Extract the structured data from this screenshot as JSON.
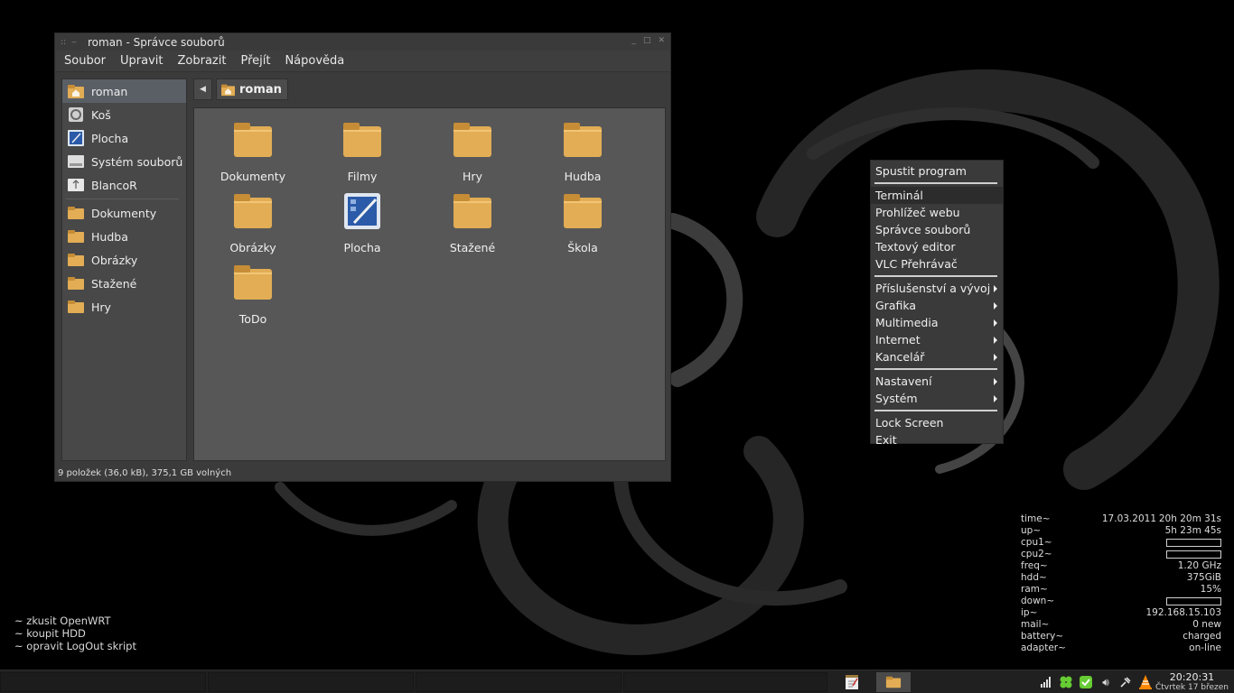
{
  "window": {
    "title": "roman - Správce souborů",
    "menu": [
      "Soubor",
      "Upravit",
      "Zobrazit",
      "Přejít",
      "Nápověda"
    ],
    "sidebar": [
      {
        "label": "roman",
        "icon": "home-icon"
      },
      {
        "label": "Koš",
        "icon": "trash-icon"
      },
      {
        "label": "Plocha",
        "icon": "desktop-icon"
      },
      {
        "label": "Systém souborů",
        "icon": "drive-icon"
      },
      {
        "label": "BlancoR",
        "icon": "usb-drive-icon"
      }
    ],
    "bookmarks": [
      "Dokumenty",
      "Hudba",
      "Obrázky",
      "Stažené",
      "Hry"
    ],
    "path": "roman",
    "files": [
      {
        "name": "Dokumenty",
        "type": "folder"
      },
      {
        "name": "Filmy",
        "type": "folder"
      },
      {
        "name": "Hry",
        "type": "folder"
      },
      {
        "name": "Hudba",
        "type": "folder"
      },
      {
        "name": "Obrázky",
        "type": "folder"
      },
      {
        "name": "Plocha",
        "type": "desktop"
      },
      {
        "name": "Stažené",
        "type": "folder"
      },
      {
        "name": "Škola",
        "type": "folder"
      },
      {
        "name": "ToDo",
        "type": "folder"
      }
    ],
    "status": "9 položek (36,0 kB), 375,1 GB volných"
  },
  "menu": {
    "run": "Spustit program",
    "apps": [
      "Terminál",
      "Prohlížeč webu",
      "Správce souborů",
      "Textový editor",
      "VLC Přehrávač"
    ],
    "highlighted": "Terminál",
    "categories": [
      "Příslušenství a vývoj",
      "Grafika",
      "Multimedia",
      "Internet",
      "Kancelář"
    ],
    "settings": [
      "Nastavení",
      "Systém"
    ],
    "session": [
      "Lock Screen",
      "Exit"
    ]
  },
  "conky": {
    "time_label": "time~",
    "date": "17.03.2011",
    "time": "20h 20m 31s",
    "up_label": "up~",
    "up": "5h 23m 45s",
    "cpu1_label": "cpu1~",
    "cpu2_label": "cpu2~",
    "freq_label": "freq~",
    "freq": "1.20 GHz",
    "hdd_label": "hdd~",
    "hdd": "375GiB",
    "ram_label": "ram~",
    "ram": "15%",
    "down_label": "down~",
    "ip_label": "ip~",
    "ip": "192.168.15.103",
    "mail_label": "mail~",
    "mail": "0 new",
    "battery_label": "battery~",
    "battery": "charged",
    "adapter_label": "adapter~",
    "adapter": "on-line"
  },
  "todo": [
    "~ zkusit OpenWRT",
    "~ koupit HDD",
    "~ opravit LogOut skript"
  ],
  "clock": {
    "time": "20:20:31",
    "date": "Čtvrtek 17 březen"
  },
  "colors": {
    "folder": "#e2ad55",
    "folder_dark": "#c68d36",
    "panel": "#3b3b3b",
    "content": "#575757"
  }
}
